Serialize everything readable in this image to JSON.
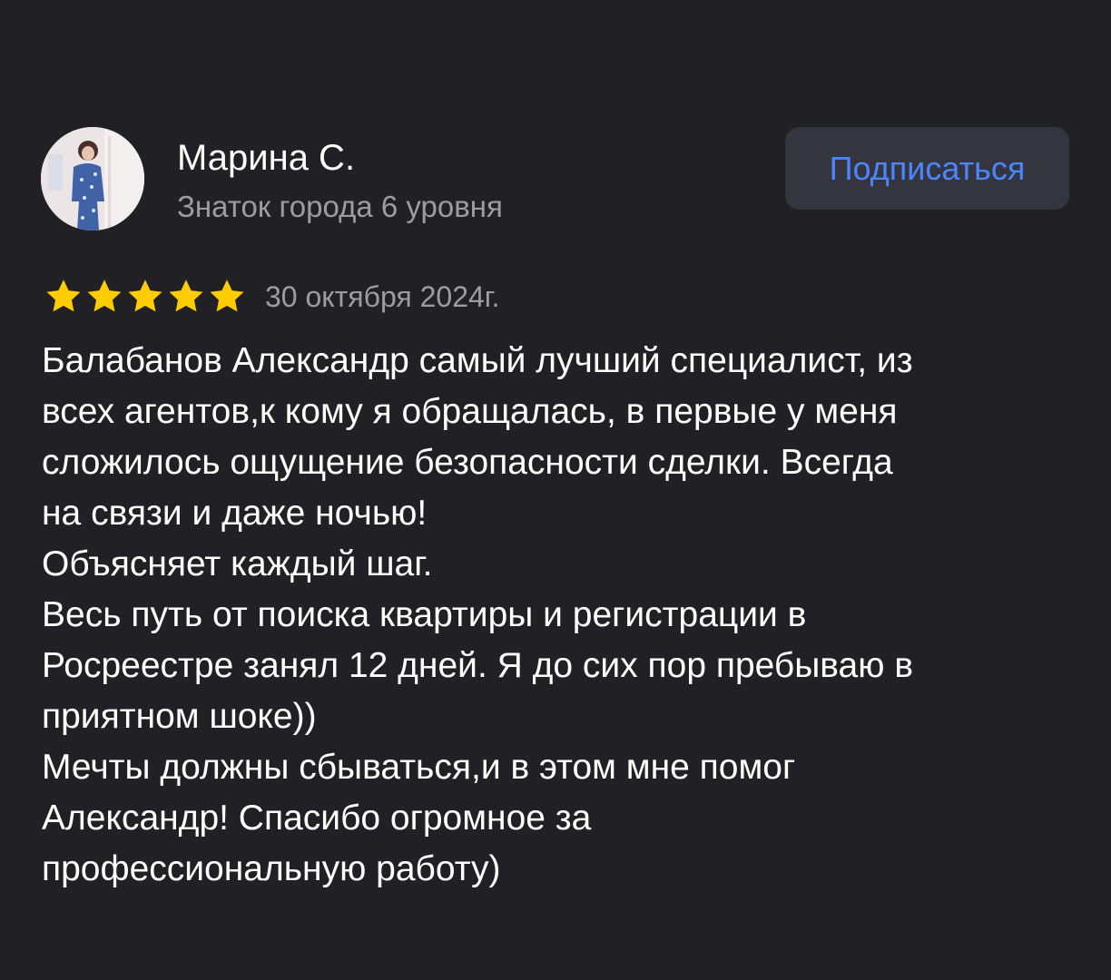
{
  "reviewer": {
    "name": "Марина С.",
    "level": "Знаток города 6 уровня",
    "avatar_icon": "user-photo"
  },
  "subscribe": {
    "label": "Подписаться",
    "color": "#4b86ff",
    "background": "#34353e"
  },
  "rating": {
    "stars": 5,
    "max": 5,
    "star_icon": "star-icon",
    "star_color": "#ffcc00",
    "date": "30 октября 2024г."
  },
  "review": {
    "lines": [
      "Балабанов Александр самый лучший специалист, из",
      "всех агентов,к кому я обращалась, в первые у меня",
      "сложилось ощущение безопасности сделки. Всегда",
      "на связи и даже ночью!",
      "Объясняет каждый шаг.",
      "Весь путь от поиска квартиры и регистрации в",
      "Росреестре занял 12 дней. Я до сих пор пребываю в",
      "приятном шоке))",
      "Мечты должны сбываться,и в этом мне помог",
      "Александр! Спасибо огромное за",
      "профессиональную работу)"
    ]
  },
  "colors": {
    "background": "#212125",
    "text_primary": "#ffffff",
    "text_secondary": "#9c9ca1"
  }
}
